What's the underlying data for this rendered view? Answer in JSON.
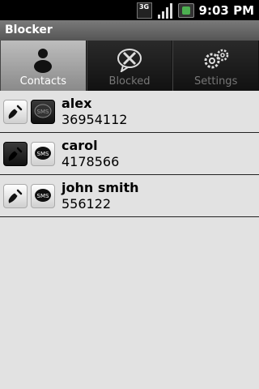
{
  "status_bar": {
    "network": "3G",
    "time": "9:03 PM",
    "icons": [
      "3g-icon",
      "signal-icon",
      "battery-icon"
    ]
  },
  "app": {
    "title": "Blocker"
  },
  "tabs": [
    {
      "label": "Contacts",
      "icon": "person-icon",
      "selected": true
    },
    {
      "label": "Blocked",
      "icon": "blocked-chat-icon",
      "selected": false
    },
    {
      "label": "Settings",
      "icon": "gears-icon",
      "selected": false
    }
  ],
  "contacts": [
    {
      "name": "alex",
      "number": "36954112",
      "call_blocked": false,
      "sms_blocked": true
    },
    {
      "name": "carol",
      "number": "4178566",
      "call_blocked": true,
      "sms_blocked": false
    },
    {
      "name": "john smith",
      "number": "556122",
      "call_blocked": false,
      "sms_blocked": false
    }
  ],
  "sms_label": "SMS",
  "colors": {
    "selected_tab": "#a5a5a5",
    "list_bg": "#e2e2e2",
    "divider": "#222222"
  }
}
